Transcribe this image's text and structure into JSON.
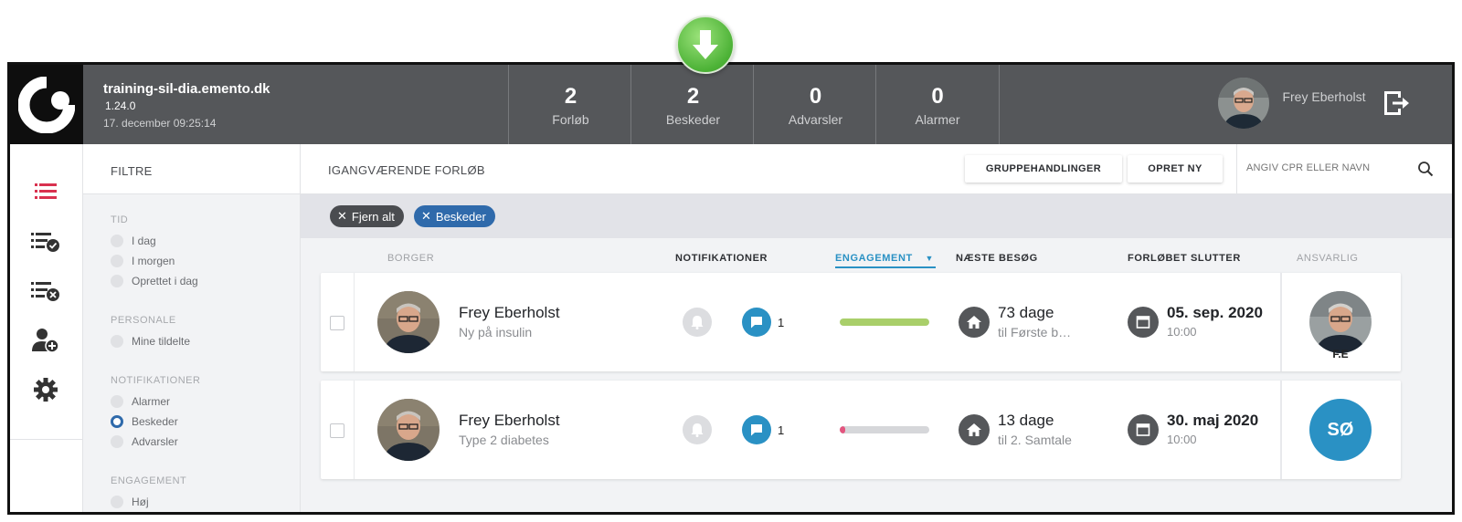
{
  "header": {
    "app_name": "training-sil-dia.emento.dk",
    "version": "1.24.0",
    "datetime": "17. december 09:25:14",
    "stats": [
      {
        "count": "2",
        "label": "Forløb"
      },
      {
        "count": "2",
        "label": "Beskeder"
      },
      {
        "count": "0",
        "label": "Advarsler"
      },
      {
        "count": "0",
        "label": "Alarmer"
      }
    ],
    "user_name": "Frey Eberholst"
  },
  "filters": {
    "title": "FILTRE",
    "groups": [
      {
        "title": "TID",
        "items": [
          {
            "label": "I dag"
          },
          {
            "label": "I morgen"
          },
          {
            "label": "Oprettet i dag"
          }
        ]
      },
      {
        "title": "PERSONALE",
        "items": [
          {
            "label": "Mine tildelte"
          }
        ]
      },
      {
        "title": "NOTIFIKATIONER",
        "items": [
          {
            "label": "Alarmer"
          },
          {
            "label": "Beskeder"
          },
          {
            "label": "Advarsler"
          }
        ]
      },
      {
        "title": "ENGAGEMENT",
        "items": [
          {
            "label": "Høj"
          }
        ]
      }
    ],
    "selected": "Beskeder"
  },
  "main": {
    "title": "IGANGVÆRENDE FORLØB",
    "group_actions_label": "GRUPPEHANDLINGER",
    "create_label": "OPRET NY",
    "search_placeholder": "ANGIV CPR ELLER NAVN",
    "chips": [
      {
        "label": "Fjern alt",
        "color": "#4a4c50"
      },
      {
        "label": "Beskeder",
        "color": "#2f6aab"
      }
    ],
    "columns": {
      "citizen": "BORGER",
      "notifications": "NOTIFIKATIONER",
      "engagement": "ENGAGEMENT",
      "next_visit": "NÆSTE BESØG",
      "ends": "FORLØBET SLUTTER",
      "responsible": "ANSVARLIG"
    },
    "rows": [
      {
        "name": "Frey Eberholst",
        "diagnosis": "Ny på insulin",
        "message_count": "1",
        "engagement": 1.0,
        "engagement_color": "#a9cf6a",
        "next_visit": "73 dage",
        "next_visit_sub": "til Første b…",
        "end_date": "05. sep. 2020",
        "end_time": "10:00",
        "responsible_initials": "F.E"
      },
      {
        "name": "Frey Eberholst",
        "diagnosis": "Type 2 diabetes",
        "message_count": "1",
        "engagement": 0.06,
        "engagement_color": "#e3557f",
        "next_visit": "13 dage",
        "next_visit_sub": "til 2. Samtale",
        "end_date": "30. maj 2020",
        "end_time": "10:00",
        "responsible_initials": "SØ"
      }
    ]
  }
}
